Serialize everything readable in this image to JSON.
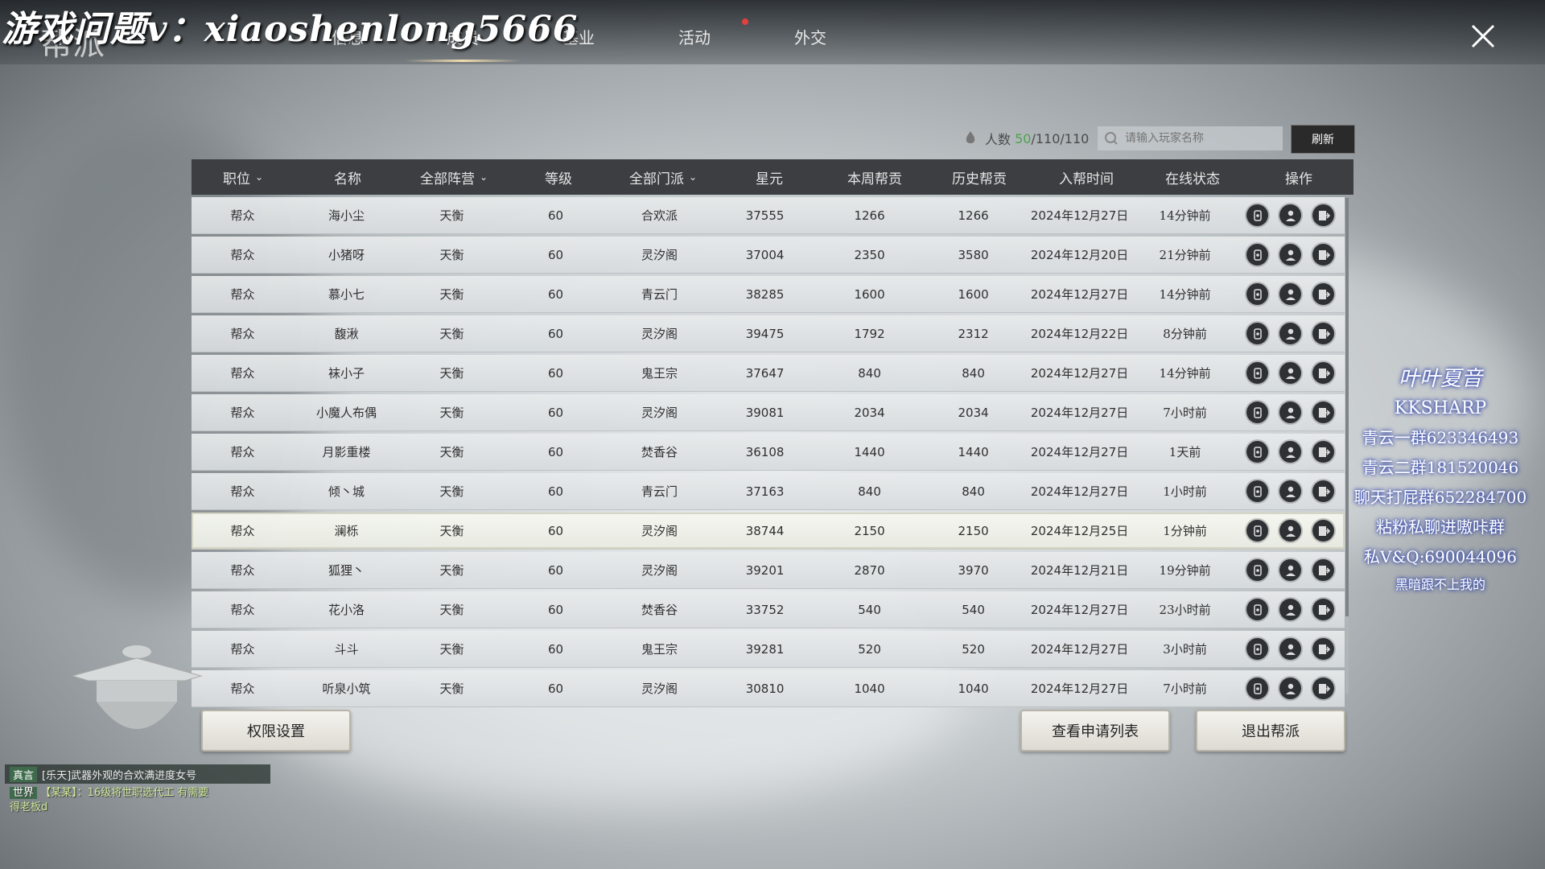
{
  "watermark": "游戏问题v：xiaoshenlong5666",
  "title": "帮派",
  "tabs": [
    {
      "label": "信息"
    },
    {
      "label": "成员"
    },
    {
      "label": "基业"
    },
    {
      "label": "活动"
    },
    {
      "label": "外交"
    }
  ],
  "active_tab": "成员",
  "member_count": {
    "label": "人数",
    "current": "50",
    "rest": "/110/110"
  },
  "search": {
    "placeholder": "请输入玩家名称"
  },
  "refresh_label": "刷新",
  "columns": [
    "职位",
    "名称",
    "全部阵营",
    "等级",
    "全部门派",
    "星元",
    "本周帮贡",
    "历史帮贡",
    "入帮时间",
    "在线状态",
    "操作"
  ],
  "rows": [
    {
      "pos": "帮众",
      "name": "海小尘",
      "camp": "天衡",
      "level": "60",
      "sect": "合欢派",
      "star": "37555",
      "week": "1266",
      "hist": "1266",
      "join": "2024年12月27日",
      "online": "14分钟前"
    },
    {
      "pos": "帮众",
      "name": "小猪呀",
      "camp": "天衡",
      "level": "60",
      "sect": "灵汐阁",
      "star": "37004",
      "week": "2350",
      "hist": "3580",
      "join": "2024年12月20日",
      "online": "21分钟前"
    },
    {
      "pos": "帮众",
      "name": "慕小七",
      "camp": "天衡",
      "level": "60",
      "sect": "青云门",
      "star": "38285",
      "week": "1600",
      "hist": "1600",
      "join": "2024年12月27日",
      "online": "14分钟前"
    },
    {
      "pos": "帮众",
      "name": "馥湫",
      "camp": "天衡",
      "level": "60",
      "sect": "灵汐阁",
      "star": "39475",
      "week": "1792",
      "hist": "2312",
      "join": "2024年12月22日",
      "online": "8分钟前"
    },
    {
      "pos": "帮众",
      "name": "袜小子",
      "camp": "天衡",
      "level": "60",
      "sect": "鬼王宗",
      "star": "37647",
      "week": "840",
      "hist": "840",
      "join": "2024年12月27日",
      "online": "14分钟前"
    },
    {
      "pos": "帮众",
      "name": "小魔人布偶",
      "camp": "天衡",
      "level": "60",
      "sect": "灵汐阁",
      "star": "39081",
      "week": "2034",
      "hist": "2034",
      "join": "2024年12月27日",
      "online": "7小时前"
    },
    {
      "pos": "帮众",
      "name": "月影重楼",
      "camp": "天衡",
      "level": "60",
      "sect": "焚香谷",
      "star": "36108",
      "week": "1440",
      "hist": "1440",
      "join": "2024年12月27日",
      "online": "1天前"
    },
    {
      "pos": "帮众",
      "name": "倾丶城",
      "camp": "天衡",
      "level": "60",
      "sect": "青云门",
      "star": "37163",
      "week": "840",
      "hist": "840",
      "join": "2024年12月27日",
      "online": "1小时前"
    },
    {
      "pos": "帮众",
      "name": "澜栎",
      "camp": "天衡",
      "level": "60",
      "sect": "灵汐阁",
      "star": "38744",
      "week": "2150",
      "hist": "2150",
      "join": "2024年12月25日",
      "online": "1分钟前"
    },
    {
      "pos": "帮众",
      "name": "狐狸丶",
      "camp": "天衡",
      "level": "60",
      "sect": "灵汐阁",
      "star": "39201",
      "week": "2870",
      "hist": "3970",
      "join": "2024年12月21日",
      "online": "19分钟前"
    },
    {
      "pos": "帮众",
      "name": "花小洛",
      "camp": "天衡",
      "level": "60",
      "sect": "焚香谷",
      "star": "33752",
      "week": "540",
      "hist": "540",
      "join": "2024年12月27日",
      "online": "23小时前"
    },
    {
      "pos": "帮众",
      "name": "斗斗",
      "camp": "天衡",
      "level": "60",
      "sect": "鬼王宗",
      "star": "39281",
      "week": "520",
      "hist": "520",
      "join": "2024年12月27日",
      "online": "3小时前"
    },
    {
      "pos": "帮众",
      "name": "听泉小筑",
      "camp": "天衡",
      "level": "60",
      "sect": "灵汐阁",
      "star": "30810",
      "week": "1040",
      "hist": "1040",
      "join": "2024年12月27日",
      "online": "7小时前"
    }
  ],
  "highlighted_row": 8,
  "buttons": {
    "permissions": "权限设置",
    "applications": "查看申请列表",
    "leave": "退出帮派"
  },
  "chat": {
    "tag": "真言",
    "line1": "[乐天]武器外观的合欢满进度女号",
    "world_tag": "世界",
    "line2": "【某某】：16级将世职选代工 有需要",
    "line3": "得老板d"
  },
  "overlay": {
    "line1": "叶叶夏音",
    "line2": "KKSHARP",
    "line3": "青云一群623346493",
    "line4": "青云二群181520046",
    "line5": "聊天打屁群652284700",
    "line6": "粘粉私聊进嗷咔群",
    "line7": "私V&Q:690044096",
    "line8": "黑暗跟不上我的"
  },
  "colors": {
    "online_count": "#4fa34f",
    "header_bg": "#3c3e41",
    "red_dot": "#e0413c"
  }
}
